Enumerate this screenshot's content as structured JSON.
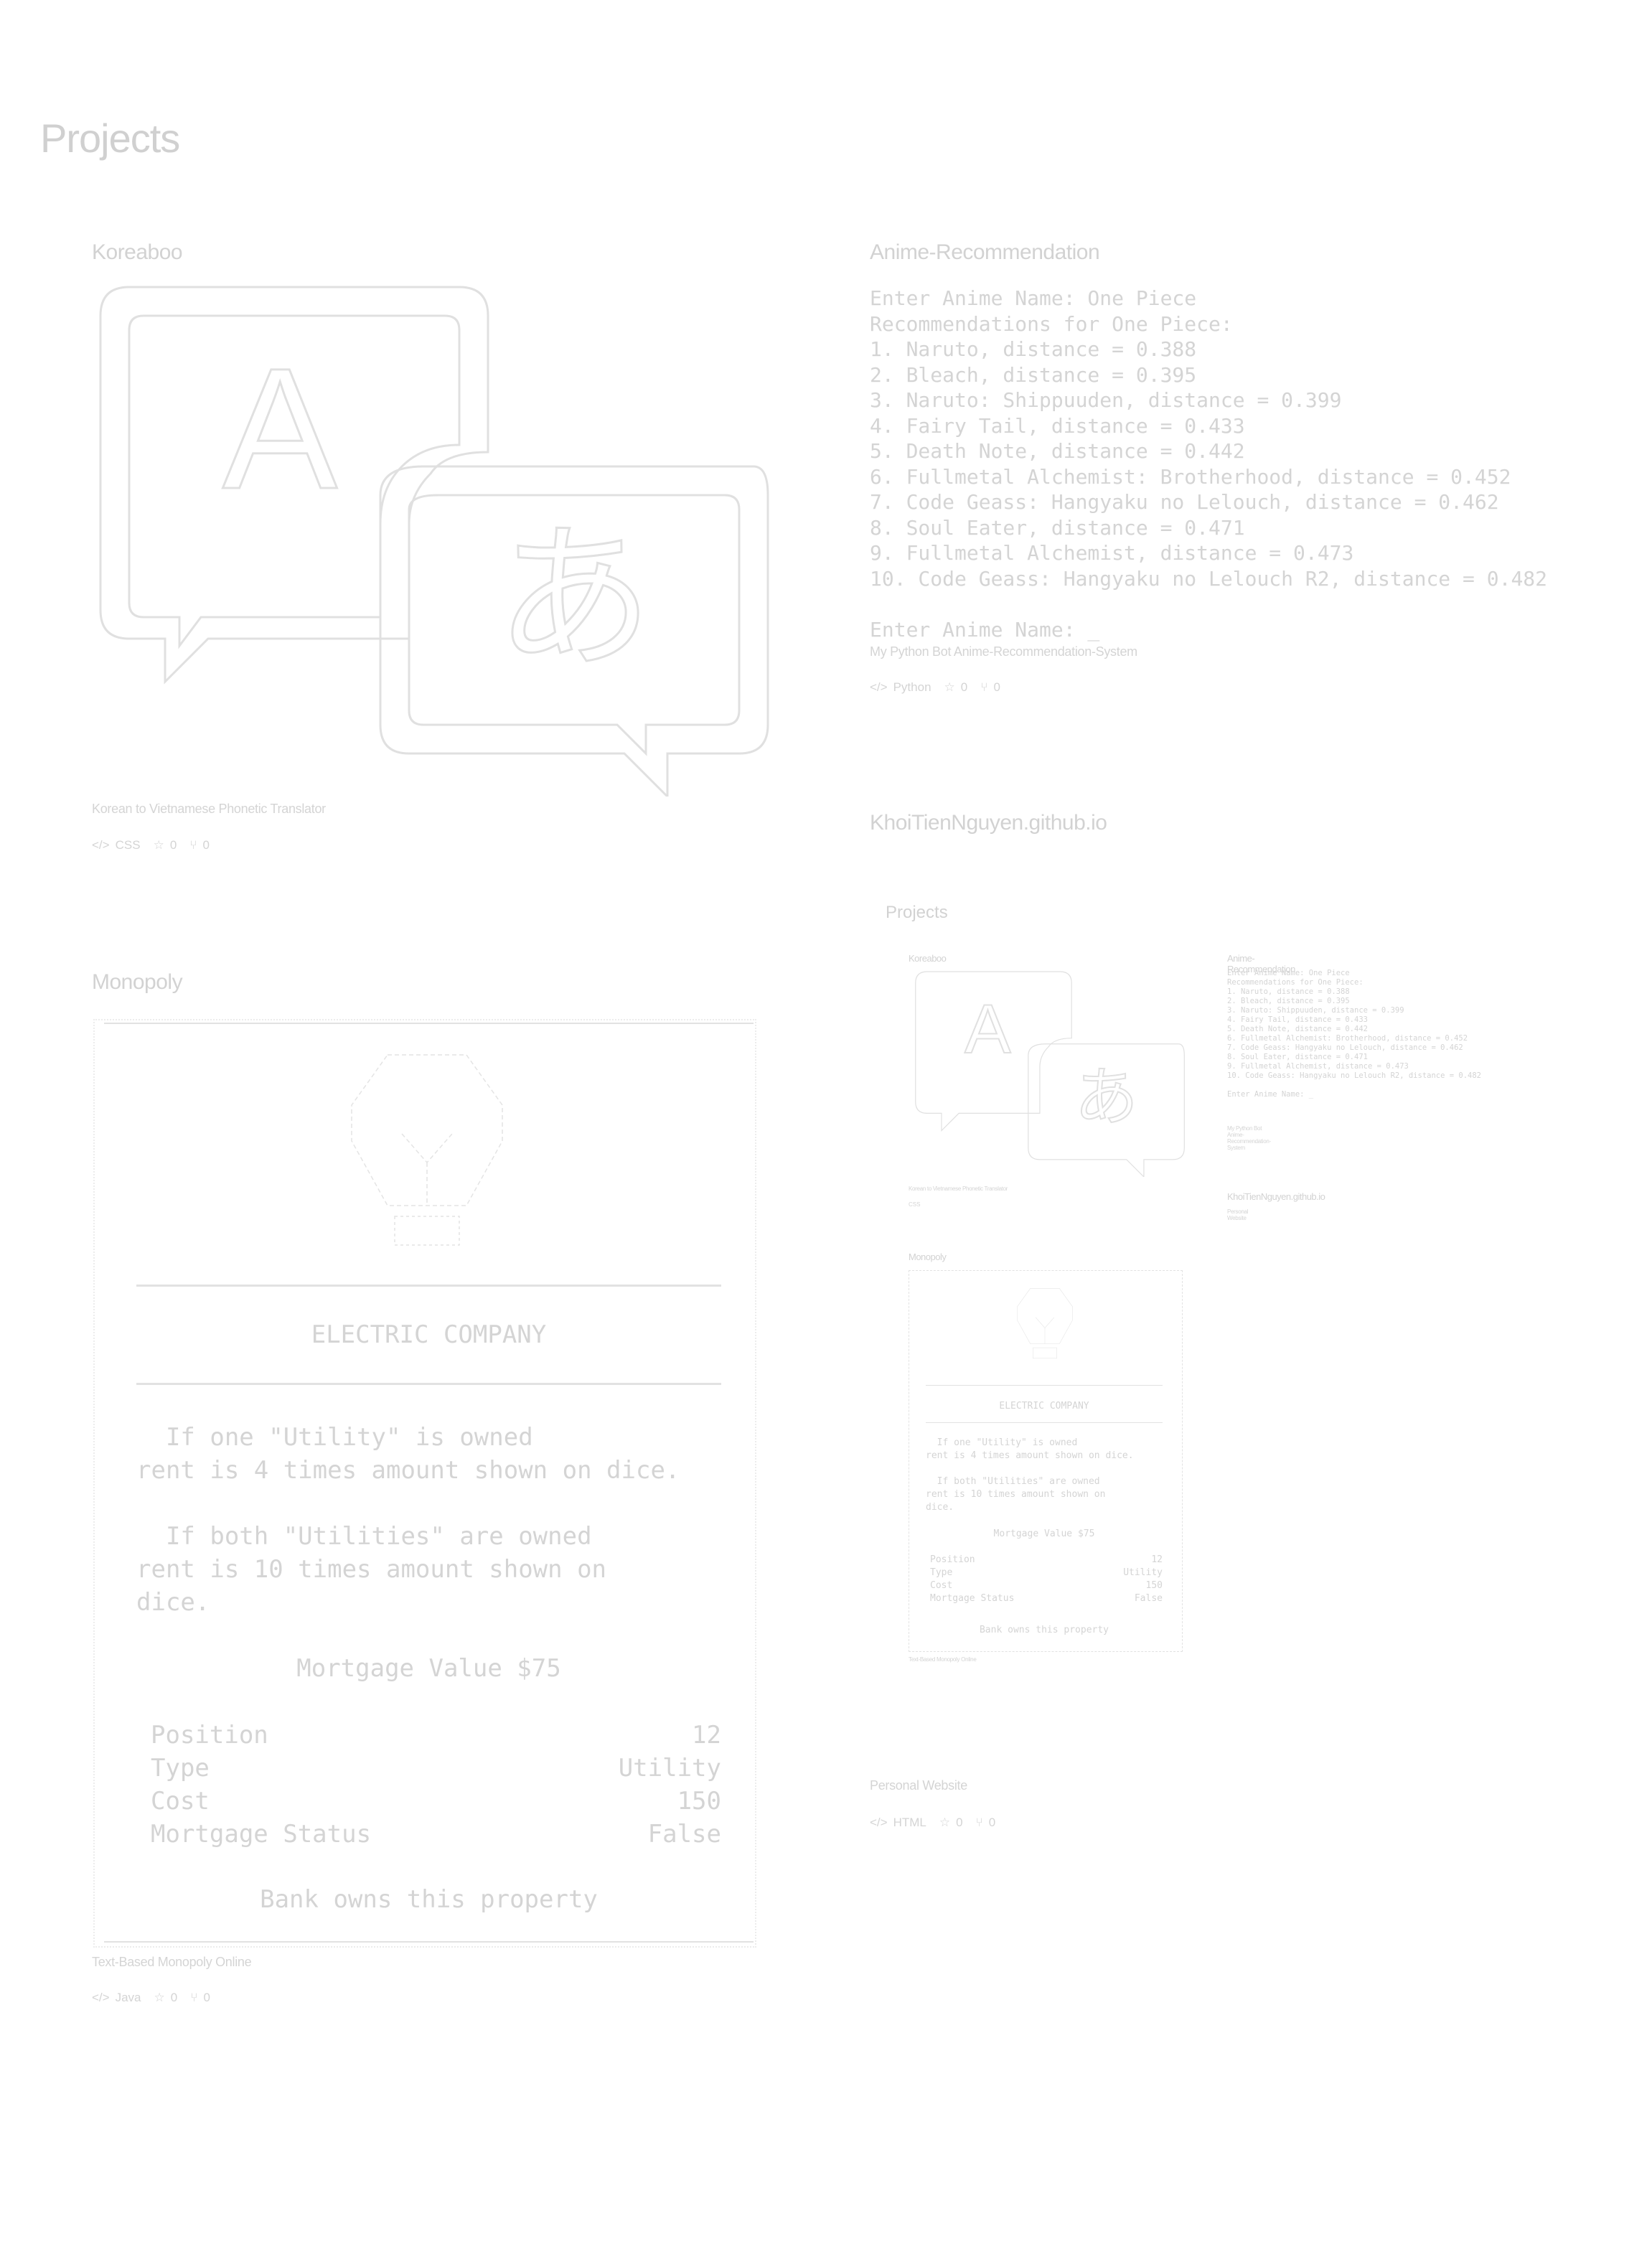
{
  "page": {
    "title": "Projects"
  },
  "cards": {
    "koreaboo": {
      "title": "Koreaboo",
      "description": "Korean to Vietnamese Phonetic Translator",
      "language": "CSS",
      "stars": "0",
      "forks": "0",
      "icon": "translate-icon",
      "glyph_a": "A",
      "glyph_b": "あ"
    },
    "anime": {
      "title": "Anime-Recommendation",
      "terminal": [
        "Enter Anime Name: One Piece",
        "Recommendations for One Piece:",
        "1. Naruto, distance = 0.388",
        "2. Bleach, distance = 0.395",
        "3. Naruto: Shippuuden, distance = 0.399",
        "4. Fairy Tail, distance = 0.433",
        "5. Death Note, distance = 0.442",
        "6. Fullmetal Alchemist: Brotherhood, distance = 0.452",
        "7. Code Geass: Hangyaku no Lelouch, distance = 0.462",
        "8. Soul Eater, distance = 0.471",
        "9. Fullmetal Alchemist, distance = 0.473",
        "10. Code Geass: Hangyaku no Lelouch R2, distance = 0.482",
        "",
        "Enter Anime Name: _"
      ],
      "description": "My Python Bot Anime-Recommendation-System",
      "language": "Python",
      "stars": "0",
      "forks": "0"
    },
    "monopoly": {
      "title": "Monopoly",
      "property_name": "ELECTRIC COMPANY",
      "rule_one": "  If one \"Utility\" is owned\nrent is 4 times amount shown on dice.",
      "rule_two": "  If both \"Utilities\" are owned\nrent is 10 times amount shown on\ndice.",
      "mortgage_value": "Mortgage Value $75",
      "table": [
        {
          "label": "Position",
          "value": "12"
        },
        {
          "label": "Type",
          "value": "Utility"
        },
        {
          "label": "Cost",
          "value": "150"
        },
        {
          "label": "Mortgage Status",
          "value": "False"
        }
      ],
      "owner": "Bank owns this property",
      "description": "Text-Based Monopoly Online",
      "language": "Java",
      "stars": "0",
      "forks": "0"
    },
    "website": {
      "title": "KhoiTienNguyen.github.io",
      "description": "Personal Website",
      "language": "HTML",
      "stars": "0",
      "forks": "0",
      "preview": {
        "page_title": "Projects",
        "koreaboo_title": "Koreaboo",
        "koreaboo_desc": "Korean to Vietnamese Phonetic Translator",
        "koreaboo_lang": "CSS",
        "anime_title": "Anime-Recommendation",
        "anime_desc": "My Python Bot Anime-Recommendation-System",
        "anime_lang": "Python",
        "site_title": "KhoiTienNguyen.github.io",
        "site_desc": "Personal Website",
        "site_lang": "HTML",
        "monopoly_title": "Monopoly",
        "monopoly_desc": "Text-Based Monopoly Online",
        "monopoly_lang": "Java"
      }
    }
  }
}
